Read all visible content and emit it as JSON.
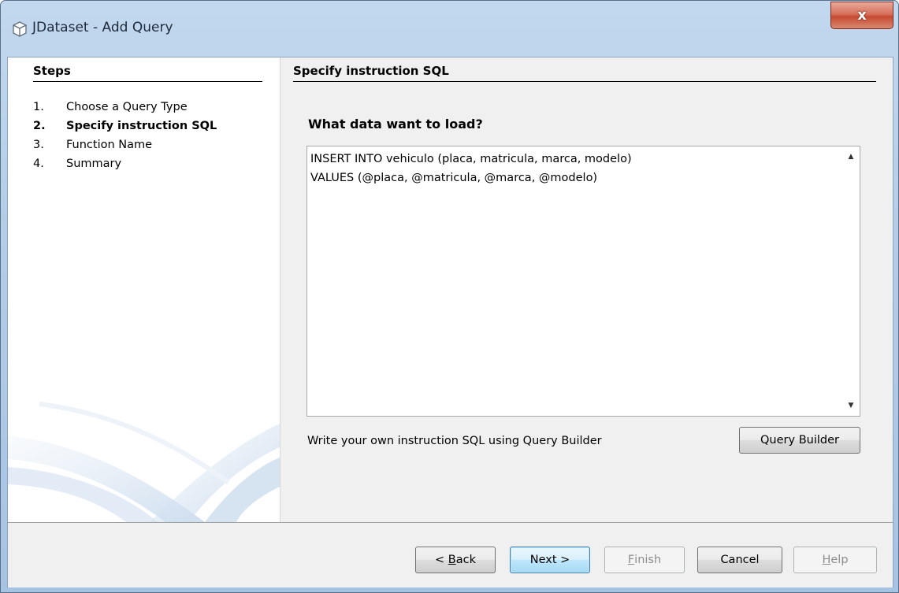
{
  "window": {
    "title": "JDataset - Add Query",
    "close_label": "x"
  },
  "steps": {
    "title": "Steps",
    "items": [
      {
        "num": "1.",
        "label": "Choose a Query Type"
      },
      {
        "num": "2.",
        "label": "Specify instruction SQL"
      },
      {
        "num": "3.",
        "label": "Function Name"
      },
      {
        "num": "4.",
        "label": "Summary"
      }
    ]
  },
  "main": {
    "title": "Specify instruction SQL",
    "question": "What data want to load?",
    "sql_text": "INSERT INTO vehiculo (placa, matricula, marca, modelo)\nVALUES (@placa, @matricula, @marca, @modelo)",
    "hint": "Write your own instruction SQL using Query Builder",
    "query_builder_label": "Query Builder"
  },
  "footer": {
    "back_pre": "< ",
    "back_mn": "B",
    "back_post": "ack",
    "next_label": "Next >",
    "finish_mn": "F",
    "finish_post": "inish",
    "cancel_label": "Cancel",
    "help_mn": "H",
    "help_post": "elp"
  },
  "colors": {
    "window_frame": "#b4cde8",
    "close_button": "#c74b33",
    "default_button": "#3c7fb1"
  }
}
